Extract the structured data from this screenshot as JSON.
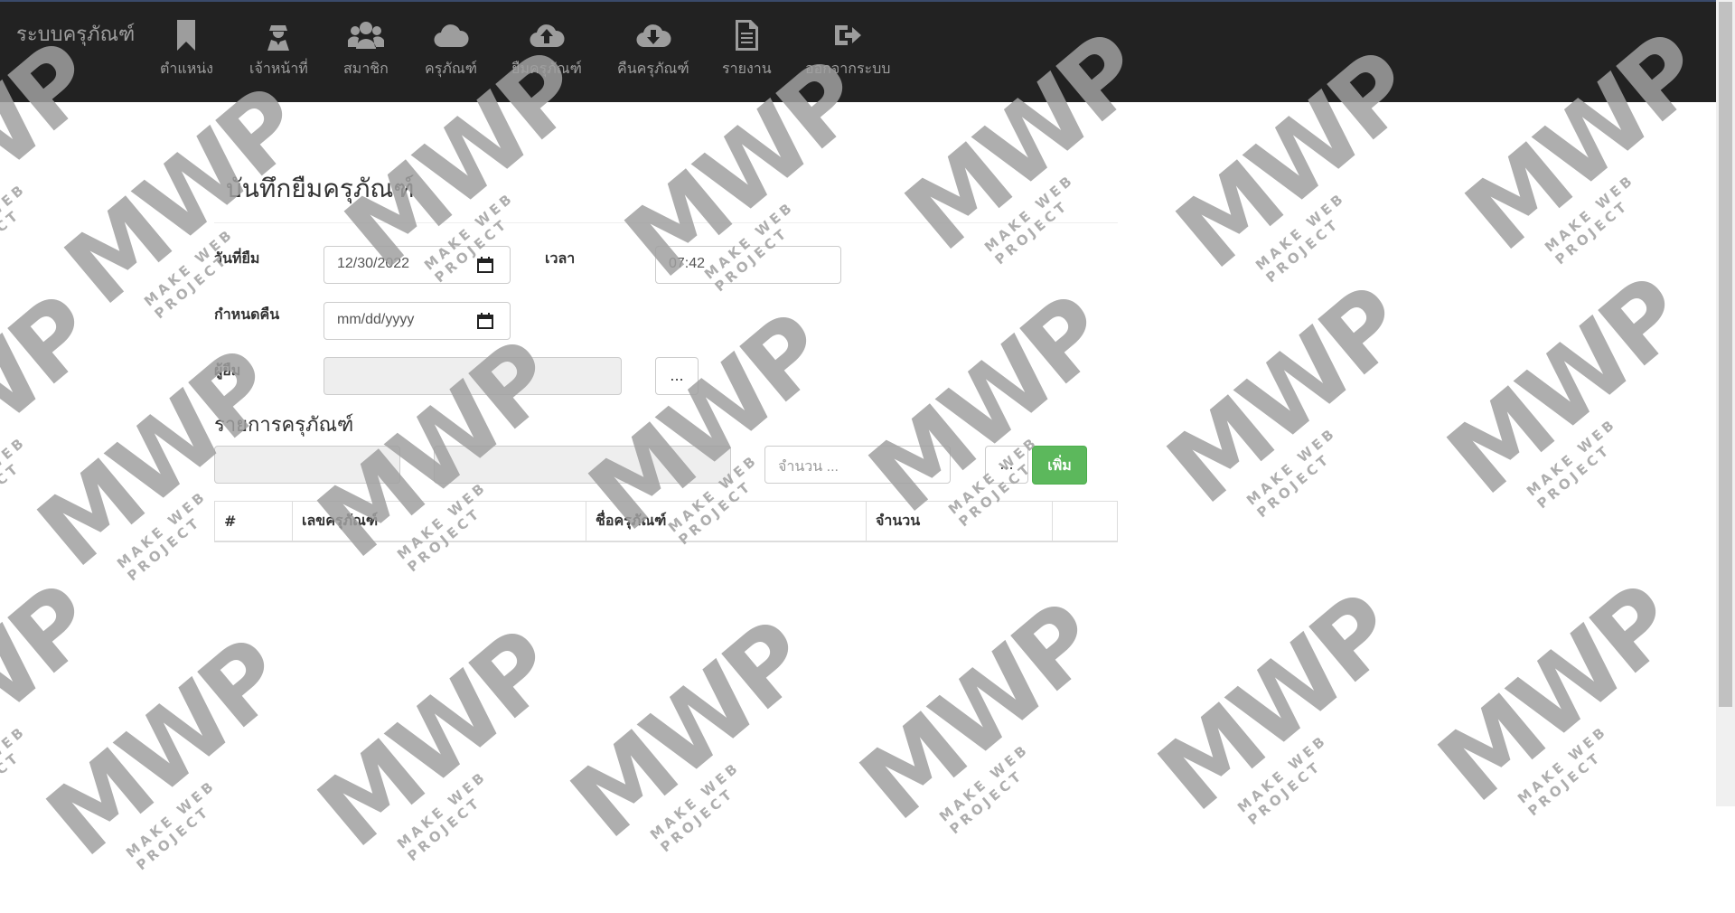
{
  "navbar": {
    "brand": "ระบบครุภัณฑ์",
    "items": [
      {
        "label": "ตำแหน่ง",
        "icon": "bookmark-icon"
      },
      {
        "label": "เจ้าหน้าที่",
        "icon": "user-secret-icon"
      },
      {
        "label": "สมาชิก",
        "icon": "users-icon"
      },
      {
        "label": "ครุภัณฑ์",
        "icon": "cloud-icon"
      },
      {
        "label": "ยืมครุภัณฑ์",
        "icon": "cloud-upload-icon"
      },
      {
        "label": "คืนครุภัณฑ์",
        "icon": "cloud-download-icon"
      },
      {
        "label": "รายงาน",
        "icon": "file-text-icon"
      },
      {
        "label": "ออกจากระบบ",
        "icon": "sign-out-icon"
      }
    ]
  },
  "page": {
    "title": "บันทึกยืมครุภัณฑ์"
  },
  "form": {
    "borrow_date_label": "วันที่ยืม",
    "borrow_date_value": "12/30/2022",
    "time_label": "เวลา",
    "time_value": "07:42",
    "due_date_label": "กำหนดคืน",
    "due_date_value": "mm/dd/yyyy",
    "borrower_label": "ผู้ยืม",
    "borrower_value": "",
    "browse_label": "..."
  },
  "items_section": {
    "title": "รายการครุภัณฑ์",
    "code_value": "",
    "name_value": "",
    "qty_placeholder": "จำนวน ...",
    "browse_label": "...",
    "add_label": "เพิ่ม",
    "table_headers": [
      "#",
      "เลขครุภัณฑ์",
      "ชื่อครุภัณฑ์",
      "จำนวน",
      ""
    ]
  },
  "watermark": {
    "logo_text": "MWP",
    "tagline": "MAKE WEB PROJECT"
  }
}
